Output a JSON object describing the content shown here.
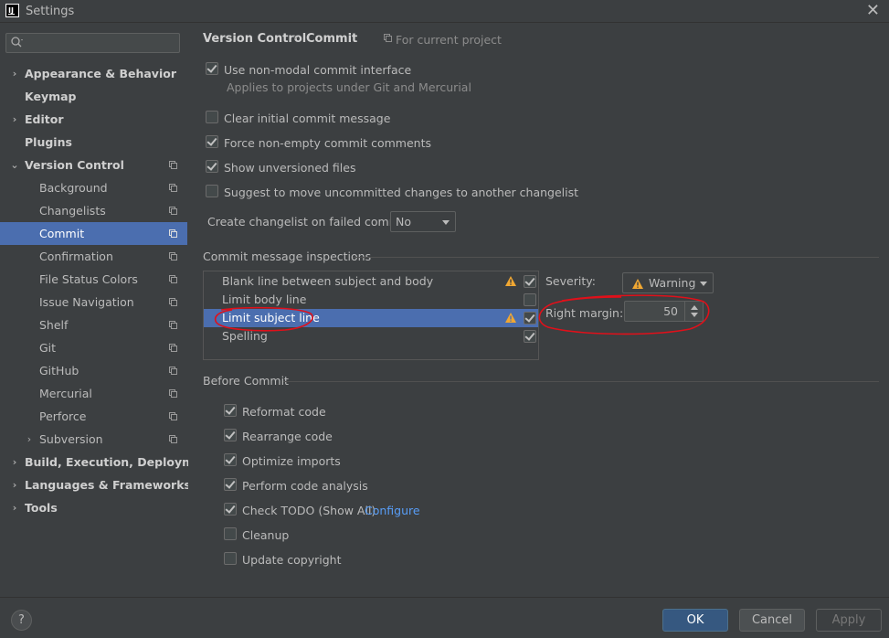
{
  "window": {
    "title": "Settings"
  },
  "search": {
    "placeholder": ""
  },
  "sidebar": {
    "items": [
      {
        "label": "Appearance & Behavior"
      },
      {
        "label": "Keymap"
      },
      {
        "label": "Editor"
      },
      {
        "label": "Plugins"
      },
      {
        "label": "Version Control"
      },
      {
        "label": "Background"
      },
      {
        "label": "Changelists"
      },
      {
        "label": "Commit"
      },
      {
        "label": "Confirmation"
      },
      {
        "label": "File Status Colors"
      },
      {
        "label": "Issue Navigation"
      },
      {
        "label": "Shelf"
      },
      {
        "label": "Git"
      },
      {
        "label": "GitHub"
      },
      {
        "label": "Mercurial"
      },
      {
        "label": "Perforce"
      },
      {
        "label": "Subversion"
      },
      {
        "label": "Build, Execution, Deployment"
      },
      {
        "label": "Languages & Frameworks"
      },
      {
        "label": "Tools"
      }
    ]
  },
  "breadcrumb": {
    "parent": "Version Control",
    "separator": "›",
    "current": "Commit",
    "scope": "For current project"
  },
  "options": {
    "non_modal": {
      "label": "Use non-modal commit interface",
      "hint": "Applies to projects under Git and Mercurial",
      "checked": true
    },
    "clear_initial": {
      "label": "Clear initial commit message",
      "checked": false
    },
    "force_nonempty": {
      "label": "Force non-empty commit comments",
      "checked": true
    },
    "show_unversioned": {
      "label": "Show unversioned files",
      "checked": true
    },
    "suggest_move": {
      "label": "Suggest to move uncommitted changes to another changelist",
      "checked": false
    }
  },
  "changelist_failed": {
    "label": "Create changelist on failed commit:",
    "value": "No"
  },
  "inspections": {
    "title": "Commit message inspections",
    "items": [
      {
        "label": "Blank line between subject and body",
        "warning": true,
        "checked": true
      },
      {
        "label": "Limit body line",
        "warning": false,
        "checked": false
      },
      {
        "label": "Limit subject line",
        "warning": true,
        "checked": true
      },
      {
        "label": "Spelling",
        "warning": false,
        "checked": true
      }
    ],
    "severity_label": "Severity:",
    "severity_value": "Warning",
    "right_margin_label": "Right margin:",
    "right_margin_value": "50"
  },
  "before_commit": {
    "title": "Before Commit",
    "items": [
      {
        "label": "Reformat code",
        "checked": true
      },
      {
        "label": "Rearrange code",
        "checked": true
      },
      {
        "label": "Optimize imports",
        "checked": true
      },
      {
        "label": "Perform code analysis",
        "checked": true
      },
      {
        "label": "Check TODO (Show All)",
        "link": "Configure",
        "checked": true
      },
      {
        "label": "Cleanup",
        "checked": false
      },
      {
        "label": "Update copyright",
        "checked": false
      }
    ]
  },
  "footer": {
    "help": "?",
    "ok": "OK",
    "cancel": "Cancel",
    "apply": "Apply"
  },
  "colors": {
    "selection": "#4b6eaf",
    "annotation": "#e0101a",
    "link": "#589df6",
    "warning": "#f0a732"
  }
}
